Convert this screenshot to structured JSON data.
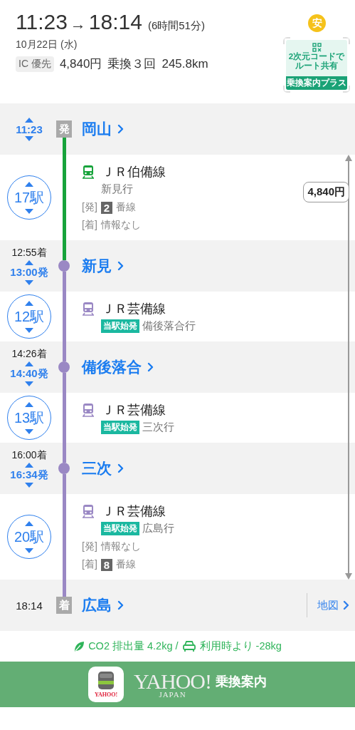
{
  "summary": {
    "depart": "11:23",
    "arrow": "→",
    "arrive": "18:14",
    "duration": "(6時間51分)",
    "date": "10月22日 (水)",
    "ic_tag": "IC 優先",
    "fare": "4,840円",
    "transfers": "乗換３回",
    "distance": "245.8km"
  },
  "safety_badge": "安",
  "qr_share": {
    "lines": [
      "2次元コードで",
      "ルート共有"
    ],
    "footer": "乗換案内プラス"
  },
  "route": [
    {
      "kind": "origin",
      "time": "11:23",
      "badge": "発",
      "name": "岡山"
    },
    {
      "kind": "segment",
      "color": "#17a33b",
      "stops": "17駅",
      "line": "ＪＲ伯備線",
      "destination": "新見行",
      "platforms": [
        {
          "label": "[発]",
          "number": "2",
          "text": "番線"
        },
        {
          "label": "[着]",
          "text": "情報なし"
        }
      ]
    },
    {
      "kind": "transfer",
      "arrival": "12:55着",
      "departure": "13:00発",
      "name": "新見"
    },
    {
      "kind": "segment",
      "color": "#9a88c4",
      "stops": "12駅",
      "line": "ＪＲ芸備線",
      "tag": "当駅始発",
      "destination": "備後落合行"
    },
    {
      "kind": "transfer",
      "arrival": "14:26着",
      "departure": "14:40発",
      "name": "備後落合"
    },
    {
      "kind": "segment",
      "color": "#9a88c4",
      "stops": "13駅",
      "line": "ＪＲ芸備線",
      "tag": "当駅始発",
      "destination": "三次行"
    },
    {
      "kind": "transfer",
      "arrival": "16:00着",
      "departure": "16:34発",
      "name": "三次"
    },
    {
      "kind": "segment",
      "color": "#9a88c4",
      "stops": "20駅",
      "line": "ＪＲ芸備線",
      "tag": "当駅始発",
      "destination": "広島行",
      "platforms": [
        {
          "label": "[発]",
          "text": "情報なし"
        },
        {
          "label": "[着]",
          "number": "8",
          "text": "番線"
        }
      ]
    },
    {
      "kind": "destination",
      "time": "18:14",
      "badge": "着",
      "name": "広島",
      "map_link": "地図"
    }
  ],
  "fare_span": "4,840円",
  "co2": {
    "emission": "CO2 排出量 4.2kg /",
    "saving": "利用時より -28kg"
  },
  "banner": {
    "app_icon_text": "YAHOO!",
    "logo": "YAHOO!",
    "logo_sub": "JAPAN",
    "service": "乗換案内"
  }
}
